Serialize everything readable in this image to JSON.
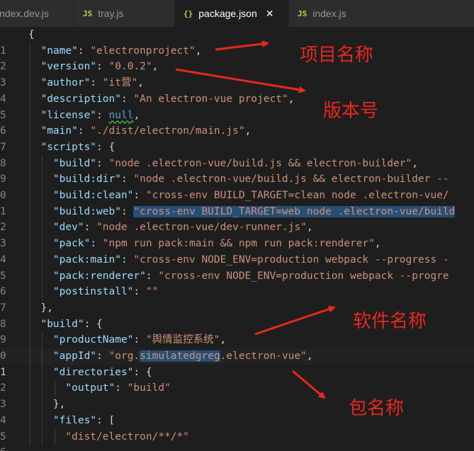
{
  "tabs": [
    {
      "icon": "",
      "label": "index.dev.js"
    },
    {
      "icon": "JS",
      "label": "tray.js"
    },
    {
      "icon": "{}",
      "label": "package.json",
      "close": "✕"
    },
    {
      "icon": "JS",
      "label": "index.js"
    }
  ],
  "line_numbers": [
    "1",
    "2",
    "3",
    "4",
    "5",
    "6",
    "7",
    "8",
    "9",
    "0",
    "1",
    "2",
    "3",
    "4",
    "5",
    "6",
    "7",
    "8",
    "9",
    "0",
    "1",
    "2",
    "3",
    "4",
    "5",
    "6"
  ],
  "code": {
    "l1": "{",
    "name_key": "\"name\"",
    "name_val": "\"electronproject\"",
    "version_key": "\"version\"",
    "version_val": "\"0.0.2\"",
    "author_key": "\"author\"",
    "author_val": "\"it营\"",
    "desc_key": "\"description\"",
    "desc_val": "\"An electron-vue project\"",
    "license_key": "\"license\"",
    "license_val": "null",
    "main_key": "\"main\"",
    "main_val": "\"./dist/electron/main.js\"",
    "scripts_key": "\"scripts\"",
    "build_key": "\"build\"",
    "build_val": "\"node .electron-vue/build.js && electron-builder\"",
    "builddir_key": "\"build:dir\"",
    "builddir_val": "\"node .electron-vue/build.js && electron-builder --",
    "buildclean_key": "\"build:clean\"",
    "buildclean_val": "\"cross-env BUILD_TARGET=clean node .electron-vue/",
    "buildweb_key": "\"build:web\"",
    "buildweb_val": "\"cross-env BUILD_TARGET=web node .electron-vue/build",
    "dev_key": "\"dev\"",
    "dev_val": "\"node .electron-vue/dev-runner.js\"",
    "pack_key": "\"pack\"",
    "pack_val": "\"npm run pack:main && npm run pack:renderer\"",
    "packmain_key": "\"pack:main\"",
    "packmain_val": "\"cross-env NODE_ENV=production webpack --progress -",
    "packrenderer_key": "\"pack:renderer\"",
    "packrenderer_val": "\"cross-env NODE_ENV=production webpack --progre",
    "postinstall_key": "\"postinstall\"",
    "postinstall_val": "\"\"",
    "close_scripts": "},",
    "build2_key": "\"build\"",
    "productname_key": "\"productName\"",
    "productname_val": "\"舆情监控系统\"",
    "appid_key": "\"appId\"",
    "appid_pre": "\"org.",
    "appid_sel": "simulatedgreg",
    "appid_post": ".electron-vue\"",
    "directories_key": "\"directories\"",
    "output_key": "\"output\"",
    "output_val": "\"build\"",
    "close_dirs": "},",
    "files_key": "\"files\"",
    "files_val": "\"dist/electron/**/*\""
  },
  "annotations": {
    "project_name": "项目名称",
    "version_number": "版本号",
    "software_name": "软件名称",
    "package_name": "包名称"
  },
  "colors": {
    "background": "#1e1e1e",
    "key": "#9cdcfe",
    "string": "#ce9178",
    "keyword": "#569cd6",
    "annotation": "#e8281e",
    "selection": "#264f78"
  }
}
